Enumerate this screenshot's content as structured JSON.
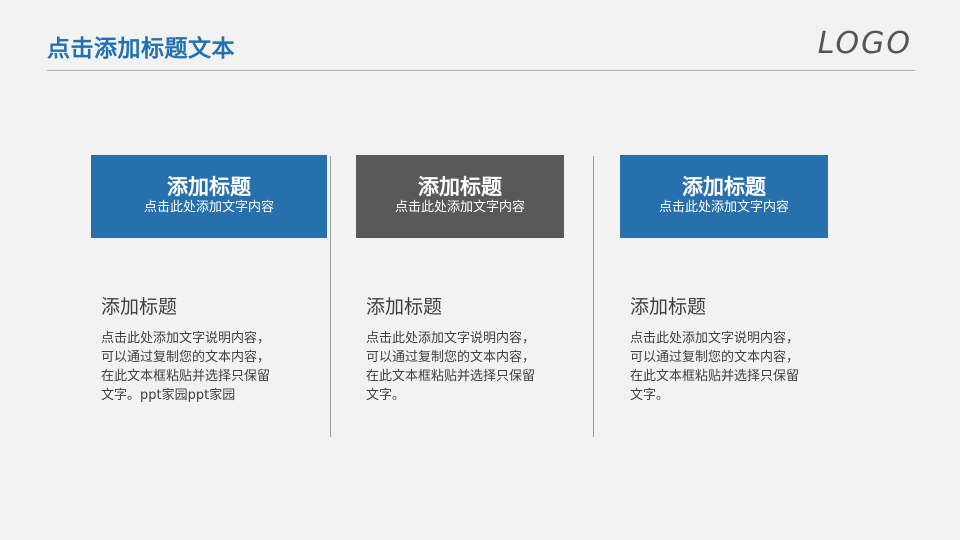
{
  "header": {
    "title": "点击添加标题文本",
    "logo": "LOGO"
  },
  "colors": {
    "accent_blue": "#2271b1",
    "box_blue": "#2671ad",
    "box_gray": "#595959",
    "background": "#f2f2f2",
    "text": "#404040"
  },
  "columns": [
    {
      "box_title": "添加标题",
      "box_subtitle": "点击此处添加文字内容",
      "box_color": "blue",
      "heading": "添加标题",
      "body": "点击此处添加文字说明内容，可以通过复制您的文本内容，在此文本框粘贴并选择只保留文字。ppt家园ppt家园"
    },
    {
      "box_title": "添加标题",
      "box_subtitle": "点击此处添加文字内容",
      "box_color": "gray",
      "heading": "添加标题",
      "body": "点击此处添加文字说明内容，可以通过复制您的文本内容，在此文本框粘贴并选择只保留文字。"
    },
    {
      "box_title": "添加标题",
      "box_subtitle": "点击此处添加文字内容",
      "box_color": "blue",
      "heading": "添加标题",
      "body": "点击此处添加文字说明内容，可以通过复制您的文本内容，在此文本框粘贴并选择只保留文字。"
    }
  ]
}
